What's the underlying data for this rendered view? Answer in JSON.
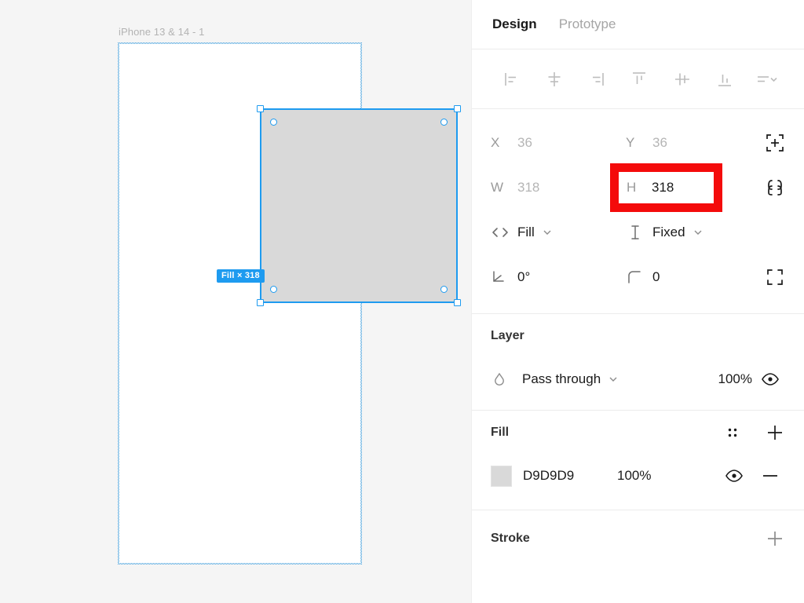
{
  "canvas": {
    "frame_label": "iPhone 13 & 14 - 1",
    "selection_badge": "Fill × 318",
    "frame_background": "#FFFFFF",
    "canvas_background": "#F5F5F5",
    "selection_color": "#1E9BF0",
    "rect_fill": "#D9D9D9"
  },
  "panel": {
    "tabs": [
      {
        "label": "Design",
        "active": true
      },
      {
        "label": "Prototype",
        "active": false
      }
    ],
    "align": [
      {
        "name": "align-left-icon"
      },
      {
        "name": "align-horizontal-center-icon"
      },
      {
        "name": "align-right-icon"
      },
      {
        "name": "align-top-icon"
      },
      {
        "name": "align-vertical-center-icon"
      },
      {
        "name": "align-bottom-icon"
      },
      {
        "name": "distribute-menu-icon"
      }
    ],
    "properties": {
      "x": {
        "label": "X",
        "value": "36"
      },
      "y": {
        "label": "Y",
        "value": "36"
      },
      "w": {
        "label": "W",
        "value": "318"
      },
      "h": {
        "label": "H",
        "value": "318",
        "highlighted": true
      },
      "horizontal_resizing": {
        "value": "Fill"
      },
      "vertical_resizing": {
        "value": "Fixed"
      },
      "rotation": {
        "value": "0°"
      },
      "corner_radius": {
        "value": "0"
      }
    },
    "layer": {
      "title": "Layer",
      "blend_mode": "Pass through",
      "opacity": "100%"
    },
    "fill": {
      "title": "Fill",
      "color_hex": "D9D9D9",
      "swatch": "#D9D9D9",
      "opacity": "100%"
    },
    "stroke": {
      "title": "Stroke"
    },
    "highlight_color": "#F40B0B"
  }
}
